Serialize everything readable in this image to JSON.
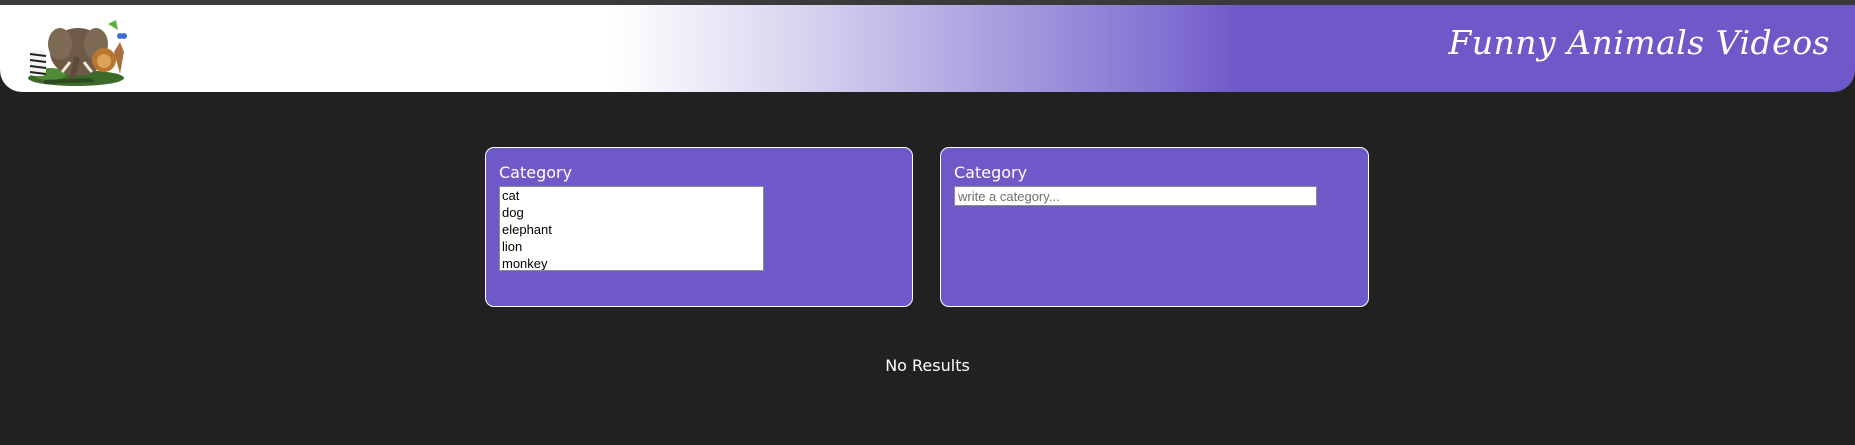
{
  "header": {
    "title": "Funny Animals Videos",
    "logo_icon": "wild-animals-logo",
    "gradient_colors": [
      "#ffffff",
      "#6f58c8"
    ]
  },
  "left_panel": {
    "label": "Category",
    "options": [
      "cat",
      "dog",
      "elephant",
      "lion",
      "monkey"
    ]
  },
  "right_panel": {
    "label": "Category",
    "input_value": "",
    "input_placeholder": "write a category..."
  },
  "results": {
    "status_text": "No Results"
  },
  "colors": {
    "background": "#212121",
    "accent": "#6f58c8",
    "text": "#ffffff"
  }
}
